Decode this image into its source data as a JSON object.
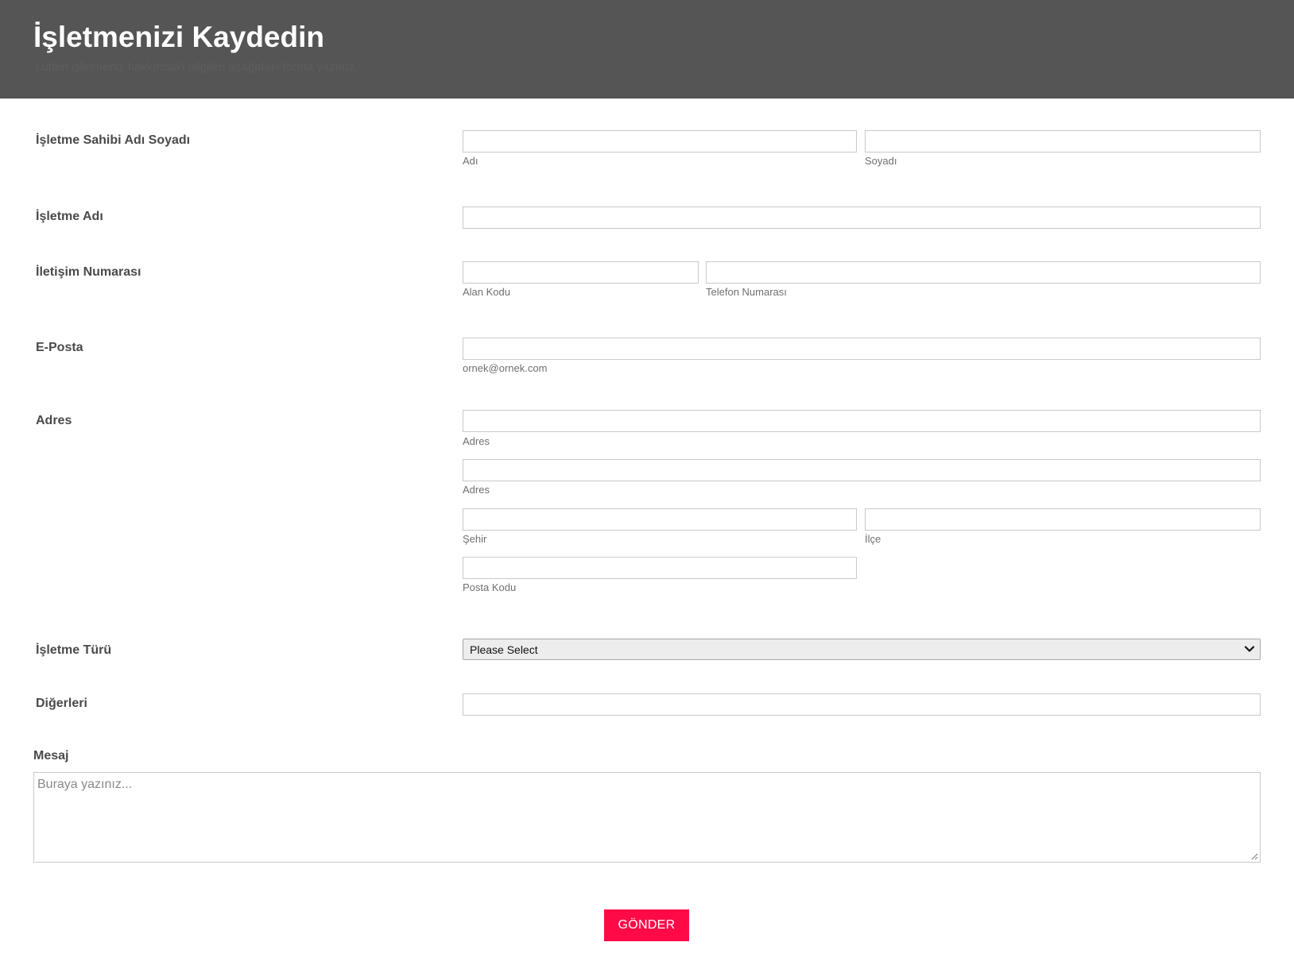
{
  "header": {
    "title": "İşletmenizi Kaydedin",
    "subtitle": "Lütfen işletmeniz hakkındaki bilgileri aşağıdaki forma yazınız."
  },
  "form": {
    "owner": {
      "label": "İşletme Sahibi Adı Soyadı",
      "first_sub": "Adı",
      "last_sub": "Soyadı"
    },
    "business_name": {
      "label": "İşletme Adı"
    },
    "phone": {
      "label": "İletişim Numarası",
      "area_sub": "Alan Kodu",
      "number_sub": "Telefon Numarası"
    },
    "email": {
      "label": "E-Posta",
      "sub": "ornek@ornek.com"
    },
    "address": {
      "label": "Adres",
      "line1_sub": "Adres",
      "line2_sub": "Adres",
      "city_sub": "Şehir",
      "district_sub": "İlçe",
      "postal_sub": "Posta Kodu"
    },
    "business_type": {
      "label": "İşletme Türü",
      "selected": "Please Select"
    },
    "others": {
      "label": "Diğerleri"
    },
    "message": {
      "label": "Mesaj",
      "placeholder": "Buraya yazınız..."
    },
    "submit_label": "GÖNDER"
  },
  "colors": {
    "header_bg": "#555555",
    "submit_bg": "#ff0a47",
    "input_border": "#c9c9c9"
  },
  "icons": {
    "select_arrow": "chevron-down-icon",
    "textarea_resize": "resize-grip-icon"
  }
}
